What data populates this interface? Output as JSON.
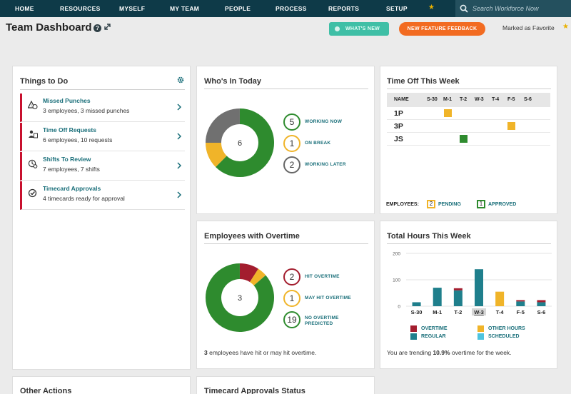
{
  "nav": {
    "items": [
      "HOME",
      "RESOURCES",
      "MYSELF",
      "MY TEAM",
      "PEOPLE",
      "PROCESS",
      "REPORTS",
      "SETUP"
    ],
    "search_placeholder": "Search Workforce Now"
  },
  "header": {
    "title": "Team Dashboard",
    "help_glyph": "?",
    "whats_new_label": "WHAT'S NEW",
    "feedback_label": "NEW FEATURE FEEDBACK",
    "favorite_label": "Marked as Favorite"
  },
  "things_to_do": {
    "title": "Things to Do",
    "items": [
      {
        "title": "Missed Punches",
        "sub": "3 employees, 3 missed punches",
        "icon": "missed-punch-icon"
      },
      {
        "title": "Time Off Requests",
        "sub": "6 employees, 10 requests",
        "icon": "time-off-request-icon"
      },
      {
        "title": "Shifts To Review",
        "sub": "7 employees, 7 shifts",
        "icon": "shift-review-icon"
      },
      {
        "title": "Timecard Approvals",
        "sub": "4 timecards ready for approval",
        "icon": "timecard-approval-icon"
      }
    ]
  },
  "whos_in": {
    "title": "Who's In Today",
    "center": "6",
    "stats": [
      {
        "value": "5",
        "label": "WORKING NOW",
        "color": "#2e8b2e"
      },
      {
        "value": "1",
        "label": "ON BREAK",
        "color": "#f0b429"
      },
      {
        "value": "2",
        "label": "WORKING LATER",
        "color": "#666666"
      }
    ],
    "colors": {
      "working": "#2e8b2e",
      "break": "#f0b429",
      "later": "#707070"
    }
  },
  "time_off": {
    "title": "Time Off This Week",
    "name_header": "NAME",
    "days": [
      "S-30",
      "M-1",
      "T-2",
      "W-3",
      "T-4",
      "F-5",
      "S-6"
    ],
    "rows": [
      {
        "name": "1P",
        "day_index": 1,
        "status": "pending"
      },
      {
        "name": "3P",
        "day_index": 5,
        "status": "pending"
      },
      {
        "name": "JS",
        "day_index": 2,
        "status": "approved"
      }
    ],
    "legend_employees": "EMPLOYEES:",
    "pending_count": "2",
    "pending_label": "PENDING",
    "approved_count": "1",
    "approved_label": "APPROVED",
    "colors": {
      "pending": "#f0b429",
      "approved": "#2e8b2e"
    }
  },
  "overtime": {
    "title": "Employees with Overtime",
    "center": "3",
    "stats": [
      {
        "value": "2",
        "label": "HIT OVERTIME",
        "color": "#a31d2e"
      },
      {
        "value": "1",
        "label": "MAY HIT OVERTIME",
        "color": "#f0b429"
      },
      {
        "value": "19",
        "label": "NO OVERTIME PREDICTED",
        "color": "#2e8b2e"
      }
    ],
    "footnote_num": "3",
    "footnote_text": " employees have hit or may hit overtime."
  },
  "total_hours": {
    "title": "Total Hours This Week",
    "legend": [
      {
        "label": "OVERTIME",
        "color": "#a31d2e"
      },
      {
        "label": "OTHER HOURS",
        "color": "#f0b429"
      },
      {
        "label": "REGULAR",
        "color": "#1f7f8c"
      },
      {
        "label": "SCHEDULED",
        "color": "#4ec4df"
      }
    ],
    "footnote_pre": "You are trending ",
    "footnote_value": "10.9%",
    "footnote_post": " overtime for the week."
  },
  "chart_data": {
    "type": "bar",
    "categories": [
      "S-30",
      "M-1",
      "T-2",
      "W-3",
      "T-4",
      "F-5",
      "S-6"
    ],
    "ylim": [
      0,
      200
    ],
    "yticks": [
      0,
      100,
      200
    ],
    "series": [
      {
        "name": "REGULAR",
        "values": [
          15,
          70,
          60,
          140,
          0,
          18,
          15
        ]
      },
      {
        "name": "OVERTIME",
        "values": [
          0,
          0,
          8,
          0,
          0,
          5,
          8
        ]
      },
      {
        "name": "OTHER HOURS",
        "values": [
          0,
          0,
          0,
          0,
          55,
          0,
          0
        ]
      },
      {
        "name": "SCHEDULED",
        "values": [
          0,
          0,
          0,
          0,
          0,
          0,
          0
        ]
      }
    ],
    "highlight_category": "W-3"
  },
  "bottom": {
    "other_actions_title": "Other Actions",
    "timecard_status_title": "Timecard Approvals Status"
  }
}
